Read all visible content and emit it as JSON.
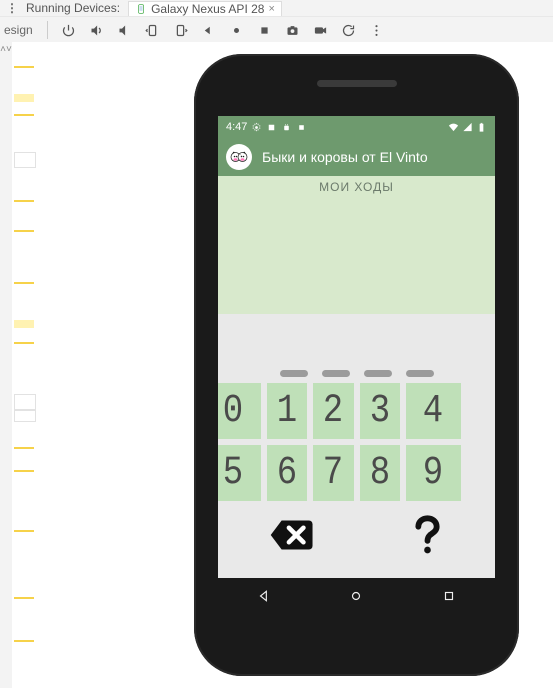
{
  "ide": {
    "running_devices_label": "Running Devices:",
    "device_tab": "Galaxy Nexus API 28",
    "side_label": "esign"
  },
  "statusbar": {
    "time": "4:47"
  },
  "app": {
    "title": "Быки и коровы от El Vinto",
    "section_title": "МОИ ХОДЫ"
  },
  "keypad": {
    "r1": [
      "0",
      "1",
      "2",
      "3",
      "4"
    ],
    "r2": [
      "5",
      "6",
      "7",
      "8",
      "9"
    ]
  }
}
